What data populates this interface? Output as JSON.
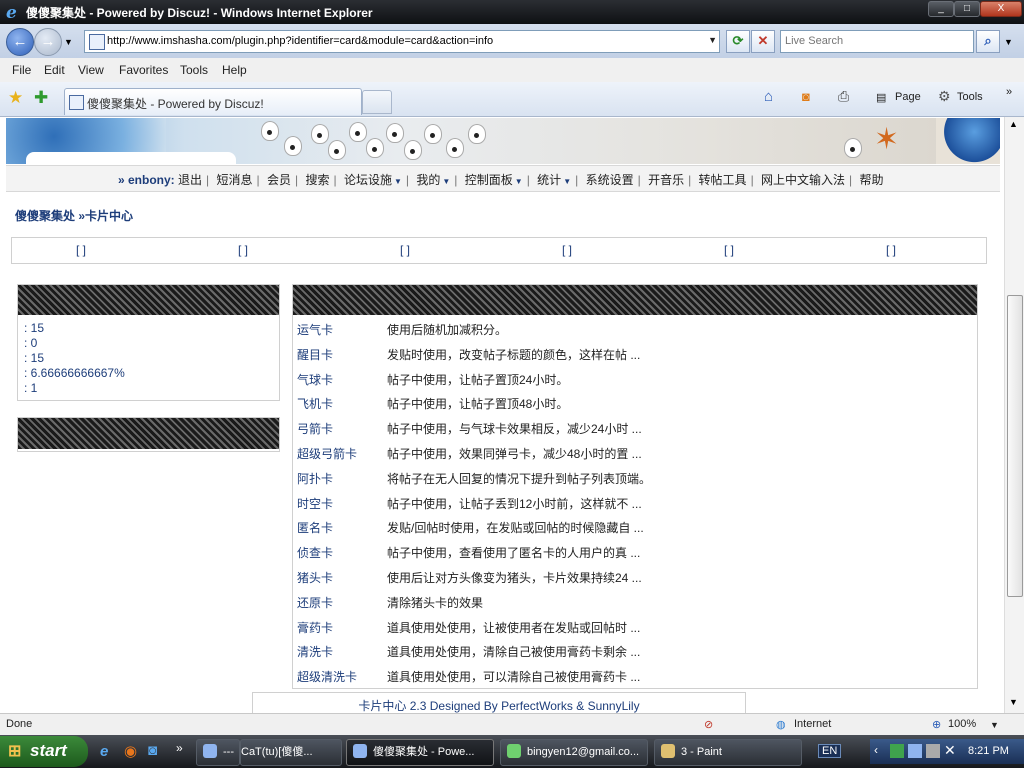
{
  "window": {
    "title": "傻傻聚集处 - Powered by Discuz! - Windows Internet Explorer",
    "min_label": "_",
    "max_label": "□",
    "close_label": "X"
  },
  "address": {
    "url": "http://www.imshasha.com/plugin.php?identifier=card&module=card&action=info",
    "search_placeholder": "Live Search",
    "back_label": "←",
    "forward_label": "→",
    "refresh_label": "⟳",
    "stop_label": "✕"
  },
  "menu": [
    "File",
    "Edit",
    "View",
    "Favorites",
    "Tools",
    "Help"
  ],
  "tab": {
    "label": "傻傻聚集处 - Powered by Discuz!"
  },
  "toolbar": {
    "page_label": "Page",
    "tools_label": "Tools"
  },
  "site": {
    "nav_user": "» enbony:",
    "nav_items": [
      "退出",
      "短消息",
      "会员",
      "搜索",
      "论坛设施",
      "我的",
      "控制面板",
      "统计",
      "系统设置",
      "开音乐",
      "转帖工具",
      "网上中文输入法",
      "帮助"
    ],
    "breadcrumb": "傻傻聚集处  »卡片中心",
    "tab_brackets": [
      "[ ]",
      "[ ]",
      "[ ]",
      "[ ]",
      "[ ]",
      "[ ]"
    ],
    "stats": [
      ": 15",
      ": 0",
      ": 15",
      ": 6.66666666667%",
      ": 1"
    ],
    "cards": [
      {
        "name": "运气卡",
        "desc": "使用后随机加减积分。"
      },
      {
        "name": "醒目卡",
        "desc": "发贴时使用，改变帖子标题的颜色，这样在帖 ..."
      },
      {
        "name": "气球卡",
        "desc": "帖子中使用，让帖子置顶24小时。"
      },
      {
        "name": "飞机卡",
        "desc": "帖子中使用，让帖子置顶48小时。"
      },
      {
        "name": "弓箭卡",
        "desc": "帖子中使用，与气球卡效果相反，减少24小时 ..."
      },
      {
        "name": "超级弓箭卡",
        "desc": "帖子中使用，效果同弹弓卡，减少48小时的置 ..."
      },
      {
        "name": "阿扑卡",
        "desc": "将帖子在无人回复的情况下提升到帖子列表顶端。"
      },
      {
        "name": "时空卡",
        "desc": "帖子中使用，让帖子丢到12小时前，这样就不 ..."
      },
      {
        "name": "匿名卡",
        "desc": "发贴/回帖时使用，在发贴或回帖的时候隐藏自 ..."
      },
      {
        "name": "侦查卡",
        "desc": "帖子中使用，查看使用了匿名卡的人用户的真 ..."
      },
      {
        "name": "猪头卡",
        "desc": "使用后让对方头像变为猪头，卡片效果持续24 ..."
      },
      {
        "name": "还原卡",
        "desc": "清除猪头卡的效果"
      },
      {
        "name": "膏药卡",
        "desc": "道具使用处使用，让被使用者在发贴或回帖时 ..."
      },
      {
        "name": "清洗卡",
        "desc": "道具使用处使用，清除自己被使用膏药卡剩余 ..."
      },
      {
        "name": "超级清洗卡",
        "desc": "道具使用处使用，可以清除自己被使用膏药卡 ..."
      }
    ],
    "footer": "卡片中心  2.3 Designed By PerfectWorks & SunnyLily"
  },
  "status": {
    "text": "Done",
    "zone": "Internet",
    "zoom": "100%"
  },
  "taskbar": {
    "start": "start",
    "tasks": [
      {
        "label": "---"
      },
      {
        "label": "CaT(tu)[傻傻..."
      },
      {
        "label": "傻傻聚集处 - Powe...",
        "active": true
      },
      {
        "label": "bingyen12@gmail.co..."
      },
      {
        "label": "3 - Paint"
      }
    ],
    "lang": "EN",
    "clock": "8:21 PM"
  }
}
